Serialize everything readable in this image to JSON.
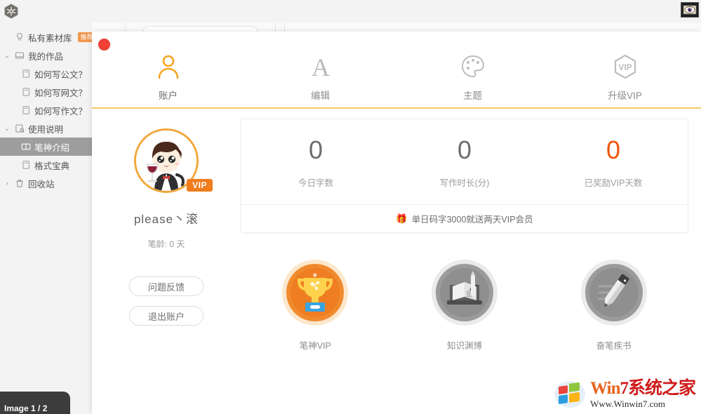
{
  "app": {
    "logo_icon": "hexagon-logo-icon",
    "preview_icon": "eye-icon"
  },
  "sidebar": {
    "items": [
      {
        "label": "私有素材库",
        "icon": "bulb-icon",
        "badge": "推荐",
        "caret": "",
        "selected": false
      },
      {
        "label": "我的作品",
        "icon": "book-icon",
        "badge": "",
        "caret": "⌄",
        "selected": false
      },
      {
        "label": "如何写公文？",
        "icon": "doc-icon",
        "badge": "",
        "caret": "",
        "selected": false,
        "indent": true
      },
      {
        "label": "如何写网文？",
        "icon": "doc-icon",
        "badge": "",
        "caret": "",
        "selected": false,
        "indent": true
      },
      {
        "label": "如何写作文？",
        "icon": "doc-icon",
        "badge": "",
        "caret": "",
        "selected": false,
        "indent": true
      },
      {
        "label": "使用说明",
        "icon": "manual-icon",
        "badge": "",
        "caret": "⌄",
        "selected": false
      },
      {
        "label": "笔神介绍",
        "icon": "open-book-icon",
        "badge": "",
        "caret": "",
        "selected": true,
        "indent": true
      },
      {
        "label": "格式宝典",
        "icon": "doc-icon",
        "badge": "",
        "caret": "",
        "selected": false,
        "indent": true
      },
      {
        "label": "回收站",
        "icon": "trash-icon",
        "badge": "",
        "caret": "›",
        "selected": false
      }
    ]
  },
  "background": {
    "search_placeholder": ""
  },
  "status_bar": {
    "text": "Image 1 / 2"
  },
  "modal": {
    "close_icon": "close-circle-icon",
    "tabs": [
      {
        "label": "账户",
        "icon": "user-icon",
        "active": true
      },
      {
        "label": "编辑",
        "icon": "letter-a-icon",
        "active": false
      },
      {
        "label": "主题",
        "icon": "palette-icon",
        "active": false
      },
      {
        "label": "升级VIP",
        "icon": "vip-hexagon-icon",
        "active": false
      }
    ],
    "profile": {
      "avatar_icon": "user-avatar-cartoon",
      "vip_chip": "VIP",
      "username": "please丶滚",
      "pen_age": "笔龄: 0 天",
      "buttons": [
        {
          "label": "问题反馈",
          "name": "feedback-button"
        },
        {
          "label": "退出账户",
          "name": "logout-button"
        }
      ]
    },
    "stats": [
      {
        "value": "0",
        "label": "今日字数",
        "accent": false
      },
      {
        "value": "0",
        "label": "写作时长(分)",
        "accent": false
      },
      {
        "value": "0",
        "label": "已奖励VIP天数",
        "accent": true
      }
    ],
    "promo": {
      "icon": "gift-icon",
      "glyph": "🎁",
      "text": "单日码字3000就送两天VIP会员"
    },
    "badges": [
      {
        "label": "笔神VIP",
        "icon": "trophy-badge-icon",
        "unlocked": true
      },
      {
        "label": "知识渊博",
        "icon": "book-a-plus-badge-icon",
        "unlocked": false
      },
      {
        "label": "奋笔疾书",
        "icon": "pencil-badge-icon",
        "unlocked": false
      }
    ]
  },
  "watermark": {
    "logo_icon": "windows-logo-icon",
    "part_win": "Win",
    "part_seven": "7",
    "part_cn": "系统之家",
    "url": "Www.Winwin7.com"
  },
  "colors": {
    "accent_orange": "#f0954a",
    "stat_accent": "#f0550a",
    "tab_underline": "#f5c96a",
    "active_tab_icon": "#f5a623",
    "sidebar_selected": "#9e9e9e",
    "close_red": "#ef4136"
  }
}
